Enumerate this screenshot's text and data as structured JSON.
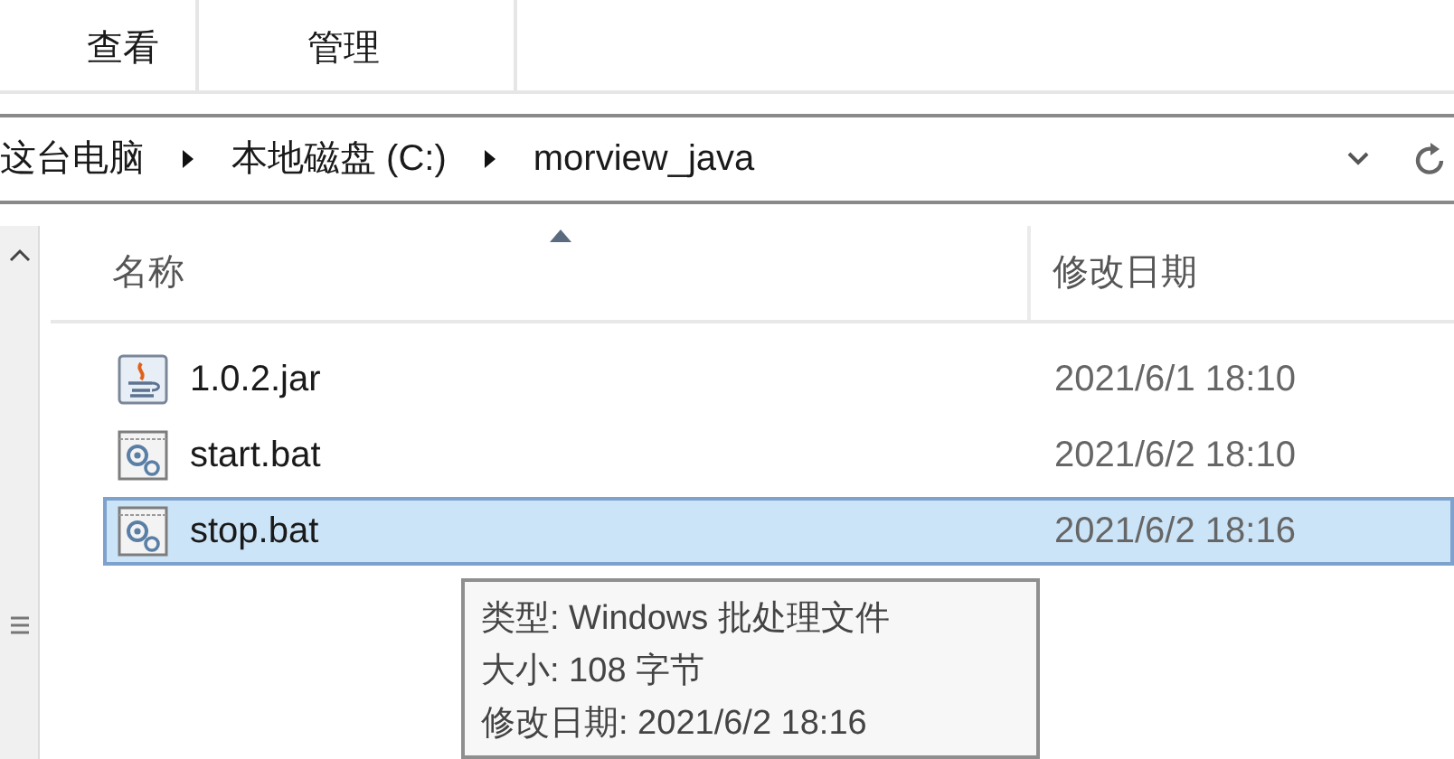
{
  "ribbon_tabs": [
    {
      "label": "查看"
    },
    {
      "label": "管理"
    }
  ],
  "address_bar": {
    "breadcrumbs": [
      "这台电脑",
      "本地磁盘 (C:)",
      "morview_java"
    ]
  },
  "columns": [
    {
      "label": "名称",
      "sorted": true
    },
    {
      "label": "修改日期",
      "sorted": false
    }
  ],
  "files": [
    {
      "name": "1.0.2.jar",
      "date": "2021/6/1 18:10",
      "kind": "jar",
      "selected": false
    },
    {
      "name": "start.bat",
      "date": "2021/6/2 18:10",
      "kind": "bat",
      "selected": false
    },
    {
      "name": "stop.bat",
      "date": "2021/6/2 18:16",
      "kind": "bat",
      "selected": true
    }
  ],
  "tooltip": {
    "lines": [
      "类型: Windows 批处理文件",
      "大小: 108 字节",
      "修改日期: 2021/6/2 18:16"
    ]
  }
}
